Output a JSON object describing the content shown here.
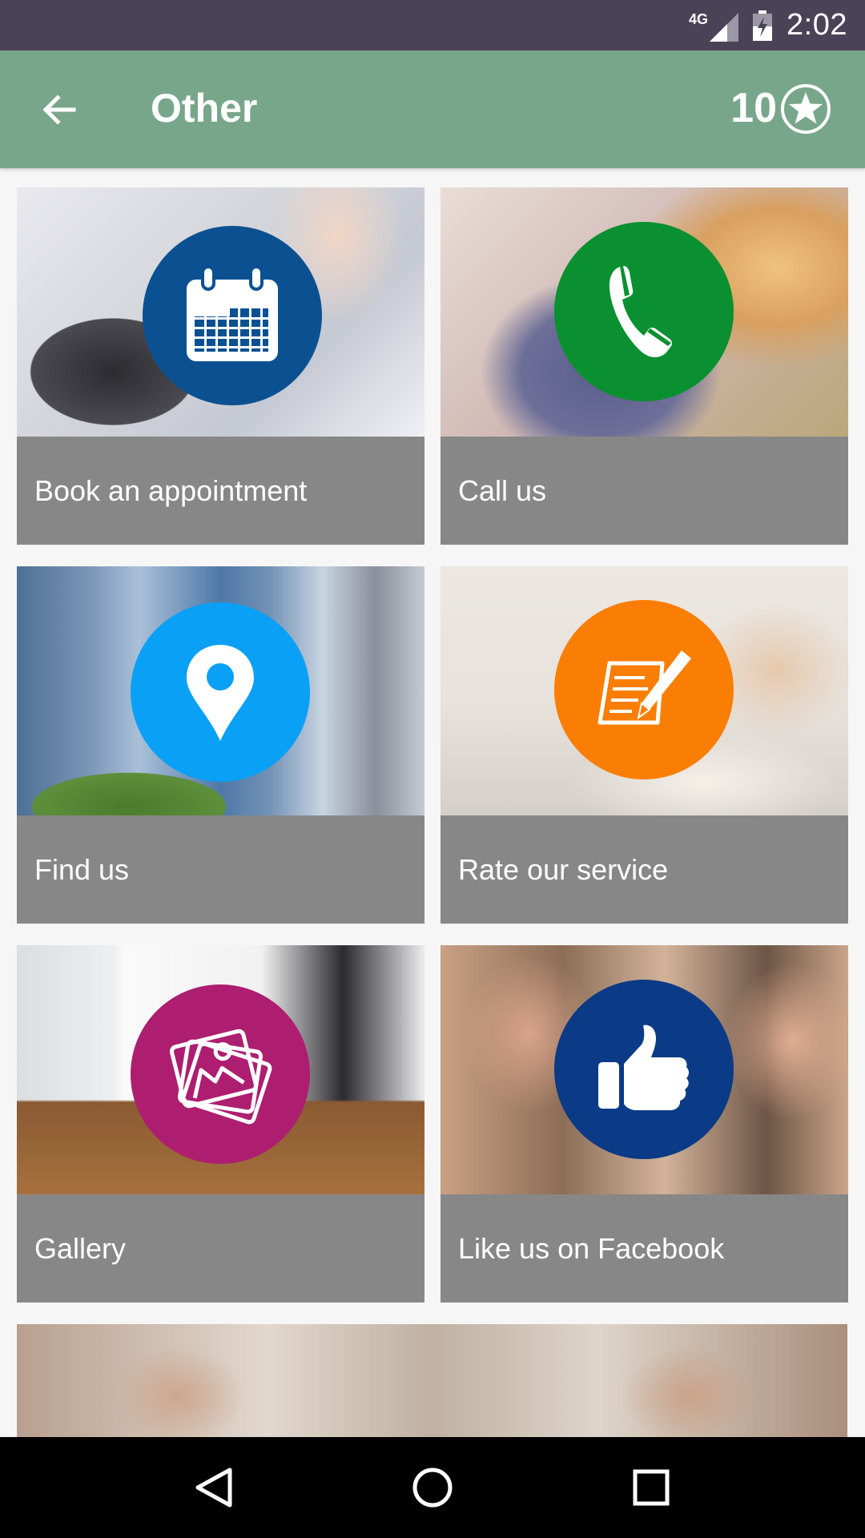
{
  "status_bar": {
    "network": "4G",
    "time": "2:02"
  },
  "app_bar": {
    "title": "Other",
    "points": "10",
    "color": "#78a68b"
  },
  "tiles": [
    {
      "label": "Book an appointment",
      "icon": "calendar-icon",
      "badge_color": "#0b5191"
    },
    {
      "label": "Call us",
      "icon": "phone-icon",
      "badge_color": "#0a9030"
    },
    {
      "label": "Find us",
      "icon": "map-pin-icon",
      "badge_color": "#0aa0f5"
    },
    {
      "label": "Rate our service",
      "icon": "form-pencil-icon",
      "badge_color": "#fb7e04"
    },
    {
      "label": "Gallery",
      "icon": "photos-icon",
      "badge_color": "#ad1e70"
    },
    {
      "label": "Like us on Facebook",
      "icon": "thumbs-up-icon",
      "badge_color": "#0b3a86"
    }
  ],
  "nav_bar": {
    "buttons": [
      "back-triangle-icon",
      "home-circle-icon",
      "recents-square-icon"
    ]
  }
}
